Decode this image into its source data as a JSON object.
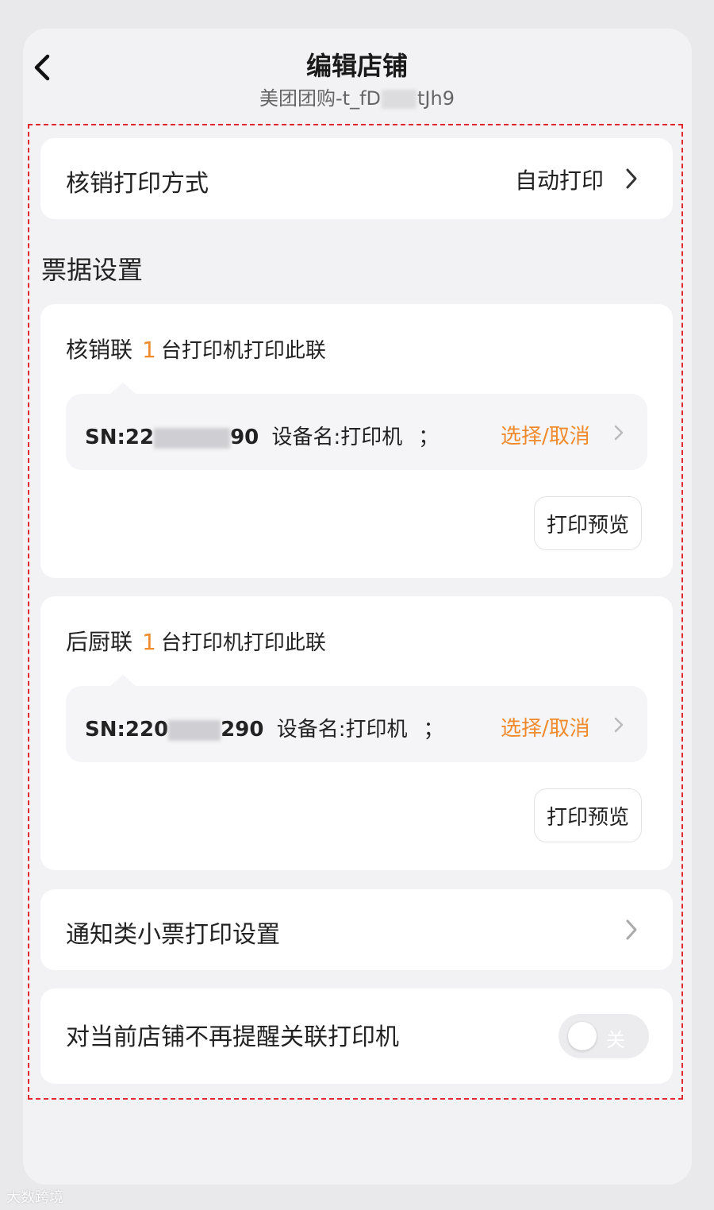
{
  "header": {
    "title": "编辑店铺",
    "subtitle_prefix": "美团团购-t_fD",
    "subtitle_suffix": "tJh9"
  },
  "verify_print": {
    "label": "核销打印方式",
    "value": "自动打印"
  },
  "ticket_section": {
    "title": "票据设置",
    "tickets": [
      {
        "name": "核销联",
        "count": "1",
        "count_suffix": "台打印机打印此联",
        "sn_prefix": "SN:22",
        "sn_suffix": "90",
        "device_label": "设备名:打印机",
        "separator": "；",
        "select_label": "选择/取消",
        "preview_label": "打印预览"
      },
      {
        "name": "后厨联",
        "count": "1",
        "count_suffix": "台打印机打印此联",
        "sn_prefix": "SN:220",
        "sn_suffix": "290",
        "device_label": "设备名:打印机",
        "separator": "；",
        "select_label": "选择/取消",
        "preview_label": "打印预览"
      }
    ]
  },
  "notice_print": {
    "label": "通知类小票打印设置"
  },
  "no_remind": {
    "label": "对当前店铺不再提醒关联打印机",
    "toggle_label": "关",
    "toggle_on": false
  },
  "watermark": "大数跨境",
  "colors": {
    "accent": "#f08a2c",
    "highlight_border": "#e0282e"
  },
  "icons": {
    "back": "chevron-left-icon",
    "row_arrow": "chevron-right-icon"
  }
}
